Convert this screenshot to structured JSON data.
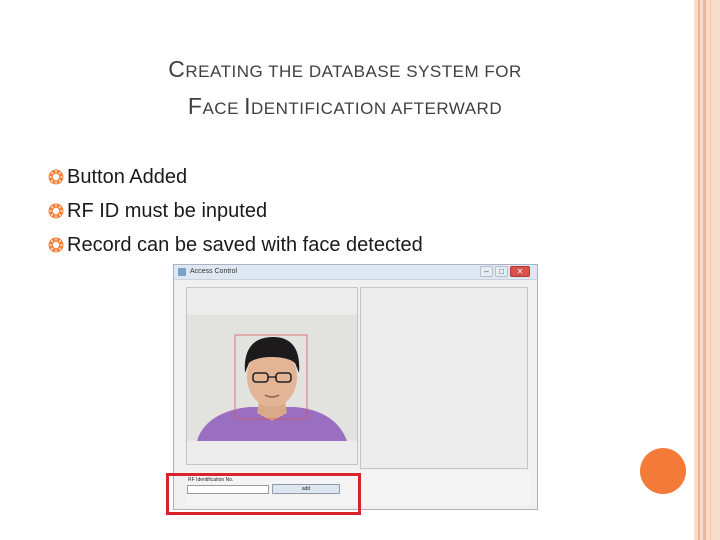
{
  "slide": {
    "title_line1": {
      "cap": "C",
      "rest": "REATING THE DATABASE SYSTEM FOR"
    },
    "title_line2": {
      "cap1": "F",
      "rest1": "ACE ",
      "cap2": "I",
      "rest2": "DENTIFICATION AFTERWARD"
    },
    "bullets": [
      "Button Added",
      "RF ID must be inputed",
      "Record can be saved with face detected"
    ],
    "bullet_icon": "sun-bullet-icon",
    "accent_color": "#f47a3a"
  },
  "app_window": {
    "title": "Access Control",
    "controls": {
      "minimize": "‒",
      "maximize": "□",
      "close": "✕"
    },
    "rf_label": "RF Identification No.",
    "rf_value": "",
    "add_button_label": "add"
  }
}
